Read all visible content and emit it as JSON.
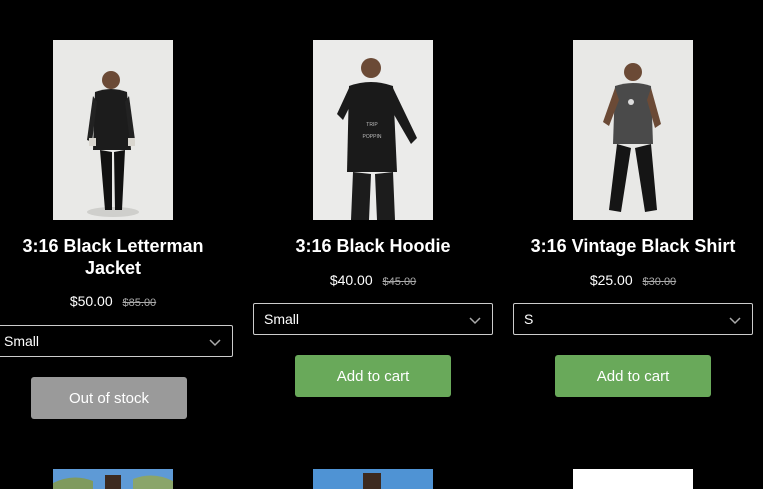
{
  "products": [
    {
      "title": "3:16 Black Letterman Jacket",
      "title_line1": "3:16 Black Letterman",
      "title_line2": "Jacket",
      "price": "$50.00",
      "compare_price": "$85.00",
      "variant": "Small",
      "button": "Out of stock",
      "button_state": "disabled"
    },
    {
      "title": "3:16 Black Hoodie",
      "price": "$40.00",
      "compare_price": "$45.00",
      "variant": "Small",
      "button": "Add to cart",
      "button_state": "enabled"
    },
    {
      "title": "3:16 Vintage Black Shirt",
      "price": "$25.00",
      "compare_price": "$30.00",
      "variant": "S",
      "button": "Add to cart",
      "button_state": "enabled"
    }
  ],
  "icons": {
    "select_arrow": "chevron-down-icon"
  },
  "colors": {
    "background": "#000000",
    "add_to_cart": "#69a95a",
    "out_of_stock": "#9a9a9a"
  }
}
